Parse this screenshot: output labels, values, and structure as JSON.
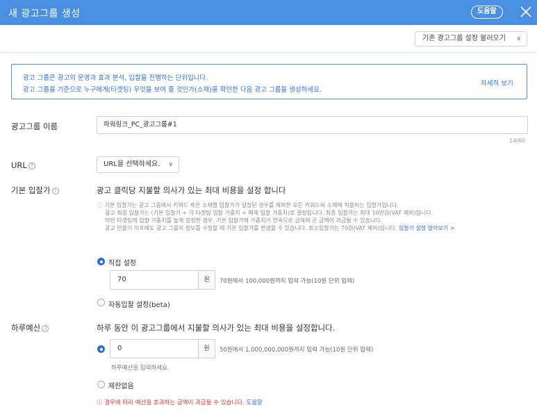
{
  "header": {
    "title": "새 광고그룹 생성",
    "help_label": "도움말"
  },
  "toolbar": {
    "load_settings_label": "기존 광고그룹 설정 불러오기"
  },
  "info": {
    "line1": "광고 그룹은 광고의 운영과 효과 분석, 입찰을 진행하는 단위입니다.",
    "line2": "광고 그룹을 기준으로 누구에게(타겟팅) 무엇을 보여 줄 것인가(소재)를 확인한 다음 광고 그룹을 생성하세요.",
    "more_label": "자세히 보기"
  },
  "name_field": {
    "label": "광고그룹 이름",
    "value": "파워링크_PC_광고그룹#1",
    "counter": "14/60"
  },
  "url_field": {
    "label": "URL",
    "select_value": "URL을 선택하세요."
  },
  "bid": {
    "label": "기본 입찰가",
    "headline": "광고 클릭당 지불할 의사가 있는 최대 비용을 설정 합니다",
    "notes": [
      "기본 입찰가는 광고 그룹에서 키워드 혹은 소재별 입찰가가 설정된 경우를 제외한 모든 키워드와 소재에 적용되는 입찰가입니다.",
      "광고 최종 입찰가는 (기본 입찰가 + 각 타겟팅 입찰 가중치 + 매체 입찰 가중치)로 결정됩니다. 최종 입찰가는 최대 10만원(VAT 제외)입니다.",
      "어떤 타겟팅에 입찰 가중치를 높게 설정한 경우, 기본 입찰가에 가중치가 연속으로 곱해져 큰 금액이 과금될 수 있습니다.",
      "광고 만들기 이후에도 광고 그룹의 정보를 수정할 때 기본 입찰가를 변경할 수 있습니다. 최소입찰가는 70원(VAT 제외)입니다."
    ],
    "notes_link": "입찰가 설정 알아보기 >",
    "option_manual": "직접 설정",
    "manual_value": "70",
    "unit": "원",
    "manual_hint": "70원에서 100,000원까지 입력 가능(10원 단위 입력)",
    "option_auto": "자동입찰 설정(beta)"
  },
  "budget": {
    "label": "하루예산",
    "headline": "하루 동안 이 광고그룹에서 지불할 의사가 있는 최대 비용을 설정합니다.",
    "value": "0",
    "unit": "원",
    "hint": "50원에서 1,000,000,000원까지 입력 가능(10원 단위 입력)",
    "sub_hint": "하루예산을 입력하세요.",
    "option_unlimited": "제한없음",
    "warning": "경우에 따라 예산을 초과하는 금액이 과금될 수 있습니다.",
    "warning_link": "도움말"
  }
}
